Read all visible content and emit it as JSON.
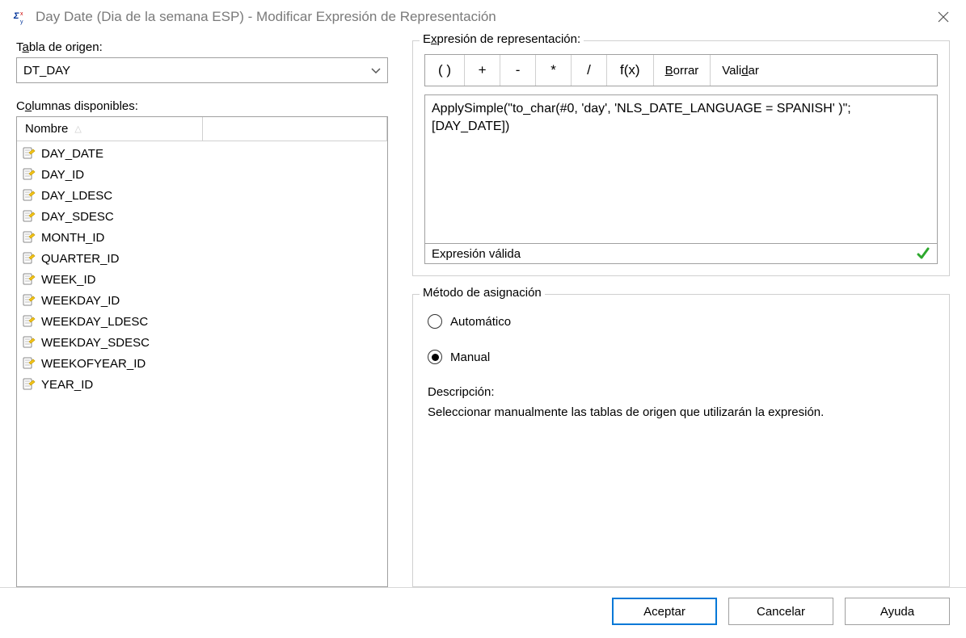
{
  "titlebar": {
    "title": "Day Date (Dia de la semana ESP) - Modificar Expresión de Representación"
  },
  "source_table": {
    "label_pre": "T",
    "label_u": "a",
    "label_post": "bla de origen:",
    "value": "DT_DAY"
  },
  "columns": {
    "label_pre": "C",
    "label_u": "o",
    "label_post": "lumnas disponibles:",
    "header_name": "Nombre",
    "items": [
      "DAY_DATE",
      "DAY_ID",
      "DAY_LDESC",
      "DAY_SDESC",
      "MONTH_ID",
      "QUARTER_ID",
      "WEEK_ID",
      "WEEKDAY_ID",
      "WEEKDAY_LDESC",
      "WEEKDAY_SDESC",
      "WEEKOFYEAR_ID",
      "YEAR_ID"
    ]
  },
  "expression": {
    "legend_pre": "E",
    "legend_u": "x",
    "legend_post": "presión de representación:",
    "toolbar": {
      "parens": "( )",
      "plus": "+",
      "minus": "-",
      "mult": "*",
      "div": "/",
      "fx": "f(x)",
      "clear_u": "B",
      "clear_post": "orrar",
      "validate_pre": "Vali",
      "validate_u": "d",
      "validate_post": "ar"
    },
    "text": "ApplySimple(\"to_char(#0, 'day', 'NLS_DATE_LANGUAGE = SPANISH' )\"; [DAY_DATE])",
    "status": "Expresión válida"
  },
  "mapping": {
    "legend": "Método de asignación",
    "auto": "Automático",
    "manual": "Manual",
    "selected": "manual",
    "desc_label": "Descripción:",
    "desc_text": "Seleccionar manualmente las tablas de origen que utilizarán la expresión."
  },
  "footer": {
    "accept": "Aceptar",
    "cancel": "Cancelar",
    "help": "Ayuda"
  }
}
